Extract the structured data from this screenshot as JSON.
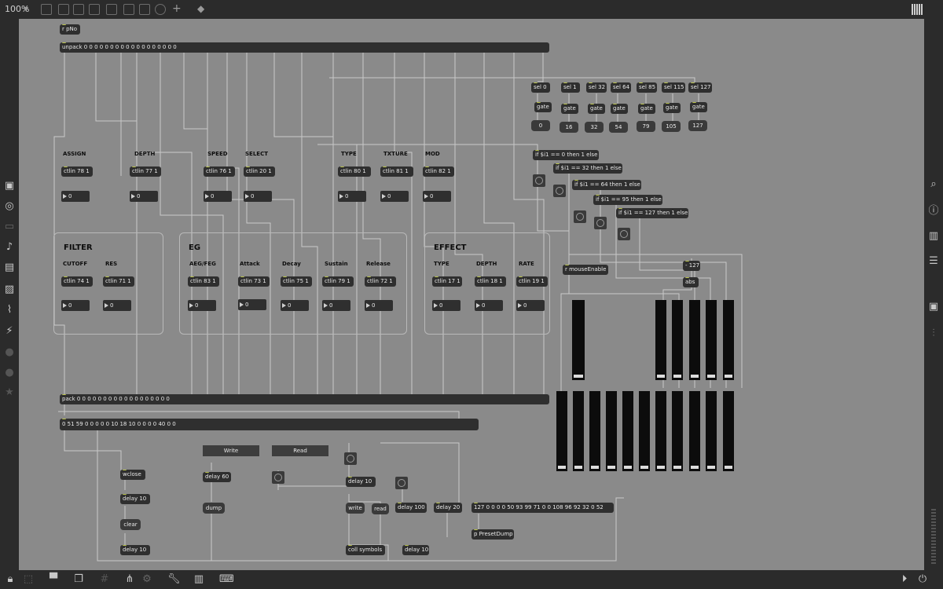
{
  "toolbar": {
    "zoom": "100%"
  },
  "objects": {
    "rpno": "r pNo",
    "unpack": "unpack 0 0 0 0 0 0 0 0 0 0 0 0 0 0 0 0 0 0",
    "pack": "pack 0 0 0 0 0 0 0 0 0 0 0 0 0 0 0 0 0 0",
    "display_list": "0 51 59 0 0 0 0 0 10 18 10 0 0 0 0 40 0 0",
    "preset_list": "127 0 0 0 0 50 93 99 71 0 0 108 96 92 32 0 52",
    "preset_dump": "p PresetDump",
    "mouse_enable": "r mouseEnable",
    "minus127": "- 127",
    "abs": "abs",
    "wclose": "wclose",
    "delay10a": "delay 10",
    "clear": "clear",
    "delay10b": "delay 10",
    "delay60": "delay 60",
    "dump": "dump",
    "delay10c": "delay 10",
    "write": "write",
    "read": "read",
    "delay100": "delay 100",
    "delay20": "delay 20",
    "coll": "coll symbols",
    "delay10d": "delay 10",
    "write_btn": "Write",
    "read_btn": "Read"
  },
  "sel_row": [
    {
      "sel": "sel 0",
      "gate": "gate",
      "msg": "0"
    },
    {
      "sel": "sel 1",
      "gate": "gate",
      "msg": "16"
    },
    {
      "sel": "sel 32",
      "gate": "gate",
      "msg": "32"
    },
    {
      "sel": "sel 64",
      "gate": "gate",
      "msg": "54"
    },
    {
      "sel": "sel 85",
      "gate": "gate",
      "msg": "79"
    },
    {
      "sel": "sel 115",
      "gate": "gate",
      "msg": "105"
    },
    {
      "sel": "sel 127",
      "gate": "gate",
      "msg": "127"
    }
  ],
  "ifs": [
    "if $i1 == 0 then 1 else 0",
    "if $i1 == 32 then 1 else 0",
    "if $i1 == 64 then 1 else 0",
    "if $i1 == 95 then 1 else 0",
    "if $i1 == 127 then 1 else 0"
  ],
  "row1": [
    {
      "label": "ASSIGN",
      "ctl": "ctlin 78 1",
      "val": "0"
    },
    {
      "label": "DEPTH",
      "ctl": "ctlin 77 1",
      "val": "0"
    },
    {
      "label": "SPEED",
      "ctl": "ctlin 76 1",
      "val": "0"
    },
    {
      "label": "SELECT",
      "ctl": "ctlin 20 1",
      "val": "0"
    },
    {
      "label": "TYPE",
      "ctl": "ctlin 80 1",
      "val": "0"
    },
    {
      "label": "TXTURE",
      "ctl": "ctlin 81 1",
      "val": "0"
    },
    {
      "label": "MOD",
      "ctl": "ctlin 82 1",
      "val": "0"
    }
  ],
  "sections": {
    "filter": "FILTER",
    "eg": "EG",
    "effect": "EFFECT"
  },
  "row2": [
    {
      "label": "CUTOFF",
      "ctl": "ctlin 74 1",
      "val": "0"
    },
    {
      "label": "RES",
      "ctl": "ctlin 71 1",
      "val": "0"
    },
    {
      "label": "AEG/FEG",
      "ctl": "ctlin 83 1",
      "val": "0"
    },
    {
      "label": "Attack",
      "ctl": "ctlin 73 1",
      "val": "0"
    },
    {
      "label": "Decay",
      "ctl": "ctlin 75 1",
      "val": "0"
    },
    {
      "label": "Sustain",
      "ctl": "ctlin 79 1",
      "val": "0"
    },
    {
      "label": "Release",
      "ctl": "ctlin 72 1",
      "val": "0"
    },
    {
      "label": "TYPE",
      "ctl": "ctlin 17 1",
      "val": "0"
    },
    {
      "label": "DEPTH",
      "ctl": "ctlin 18 1",
      "val": "0"
    },
    {
      "label": "RATE",
      "ctl": "ctlin 19 1",
      "val": "0"
    }
  ],
  "colors": {
    "canvas": "#8a8a8a",
    "object": "#2f2f2f",
    "chrome": "#2b2b2b",
    "accent": "#b9c24a"
  }
}
